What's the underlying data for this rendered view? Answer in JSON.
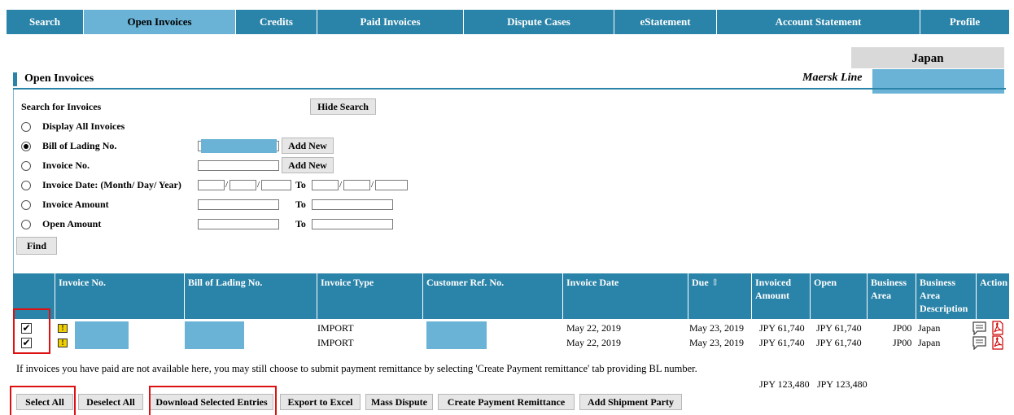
{
  "nav": {
    "tabs": [
      {
        "label": "Search",
        "active": false
      },
      {
        "label": "Open Invoices",
        "active": true
      },
      {
        "label": "Credits",
        "active": false
      },
      {
        "label": "Paid Invoices",
        "active": false
      },
      {
        "label": "Dispute Cases",
        "active": false
      },
      {
        "label": "eStatement",
        "active": false
      },
      {
        "label": "Account Statement",
        "active": false
      },
      {
        "label": "Profile",
        "active": false
      }
    ]
  },
  "header": {
    "country": "Japan",
    "company": "Maersk Line",
    "page_title": "Open Invoices"
  },
  "search": {
    "heading": "Search for Invoices",
    "hide_button": "Hide Search",
    "options": {
      "display_all": "Display All Invoices",
      "bill_of_lading": "Bill of Lading No.",
      "invoice_no": "Invoice No.",
      "invoice_date": "Invoice Date:  (Month/ Day/ Year)",
      "invoice_amount": "Invoice Amount",
      "open_amount": "Open Amount"
    },
    "selected_option": "bill_of_lading",
    "add_new": "Add New",
    "to": "To",
    "date_sep": "/",
    "find_button": "Find"
  },
  "table": {
    "headers": {
      "invoice_no": "Invoice No.",
      "bill_of_lading": "Bill of Lading No.",
      "invoice_type": "Invoice Type",
      "customer_ref": "Customer Ref. No.",
      "invoice_date": "Invoice Date",
      "due": "Due",
      "due_sort": "⇕",
      "invoiced_amount_1": "Invoiced",
      "invoiced_amount_2": "Amount",
      "open": "Open",
      "business_area_1": "Business",
      "business_area_2": "Area",
      "ba_desc_1": "Business",
      "ba_desc_2": "Area",
      "ba_desc_3": "Description",
      "action": "Action"
    },
    "rows": [
      {
        "checked": true,
        "info_badge": "!",
        "invoice_type": "IMPORT",
        "invoice_date": "May 22, 2019",
        "due": "May 23, 2019",
        "invoiced": "JPY 61,740",
        "open": "JPY 61,740",
        "business_area": "JP00",
        "ba_desc": "Japan"
      },
      {
        "checked": true,
        "info_badge": "!",
        "invoice_type": "IMPORT",
        "invoice_date": "May 22, 2019",
        "due": "May 23, 2019",
        "invoiced": "JPY 61,740",
        "open": "JPY 61,740",
        "business_area": "JP00",
        "ba_desc": "Japan"
      }
    ],
    "check_mark": "✔",
    "totals": {
      "invoiced": "JPY 123,480",
      "open": "JPY 123,480"
    }
  },
  "note": "If invoices you have paid are not available here, you may still choose to submit payment remittance by selecting 'Create Payment remittance' tab providing BL number.",
  "actions": {
    "select_all": "Select All",
    "deselect_all": "Deselect All",
    "download_selected": "Download Selected Entries",
    "export_excel": "Export to Excel",
    "mass_dispute": "Mass Dispute",
    "create_payment": "Create Payment Remittance",
    "add_shipment_party": "Add Shipment Party"
  },
  "colors": {
    "nav_bg": "#2a83a8",
    "nav_active": "#6ab3d6",
    "redaction": "#6ab3d6",
    "highlight": "#dd1111"
  },
  "icons": [
    "comment-icon",
    "pdf-icon",
    "info-icon"
  ]
}
